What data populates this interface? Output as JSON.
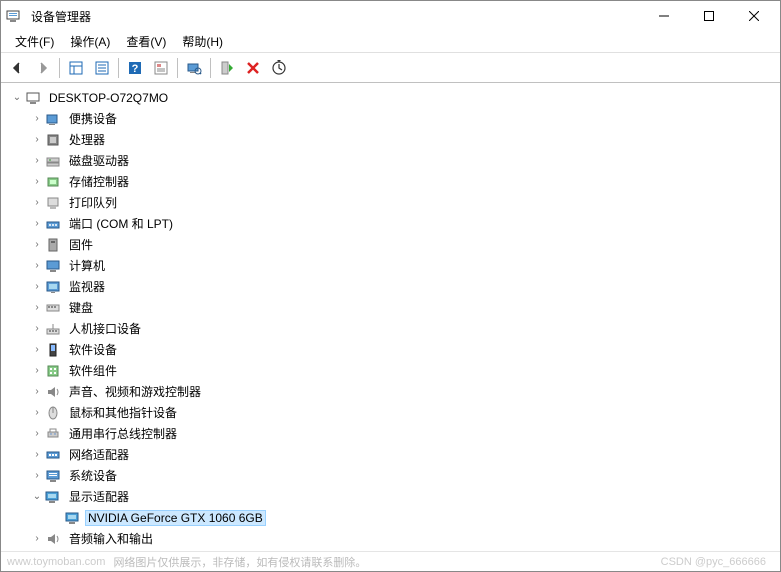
{
  "window": {
    "title": "设备管理器"
  },
  "menu": {
    "file": "文件(F)",
    "action": "操作(A)",
    "view": "查看(V)",
    "help": "帮助(H)"
  },
  "tree": {
    "root": "DESKTOP-O72Q7MO",
    "items": [
      "便携设备",
      "处理器",
      "磁盘驱动器",
      "存储控制器",
      "打印队列",
      "端口 (COM 和 LPT)",
      "固件",
      "计算机",
      "监视器",
      "键盘",
      "人机接口设备",
      "软件设备",
      "软件组件",
      "声音、视频和游戏控制器",
      "鼠标和其他指针设备",
      "通用串行总线控制器",
      "网络适配器",
      "系统设备"
    ],
    "display_adapters": "显示适配器",
    "gpu": "NVIDIA GeForce GTX 1060 6GB",
    "audio": "音频输入和输出"
  },
  "footer": {
    "watermark1": "www.toymoban.com",
    "watermark2": "网络图片仅供展示，非存储，如有侵权请联系删除。",
    "watermark3": "CSDN @pyc_666666"
  }
}
